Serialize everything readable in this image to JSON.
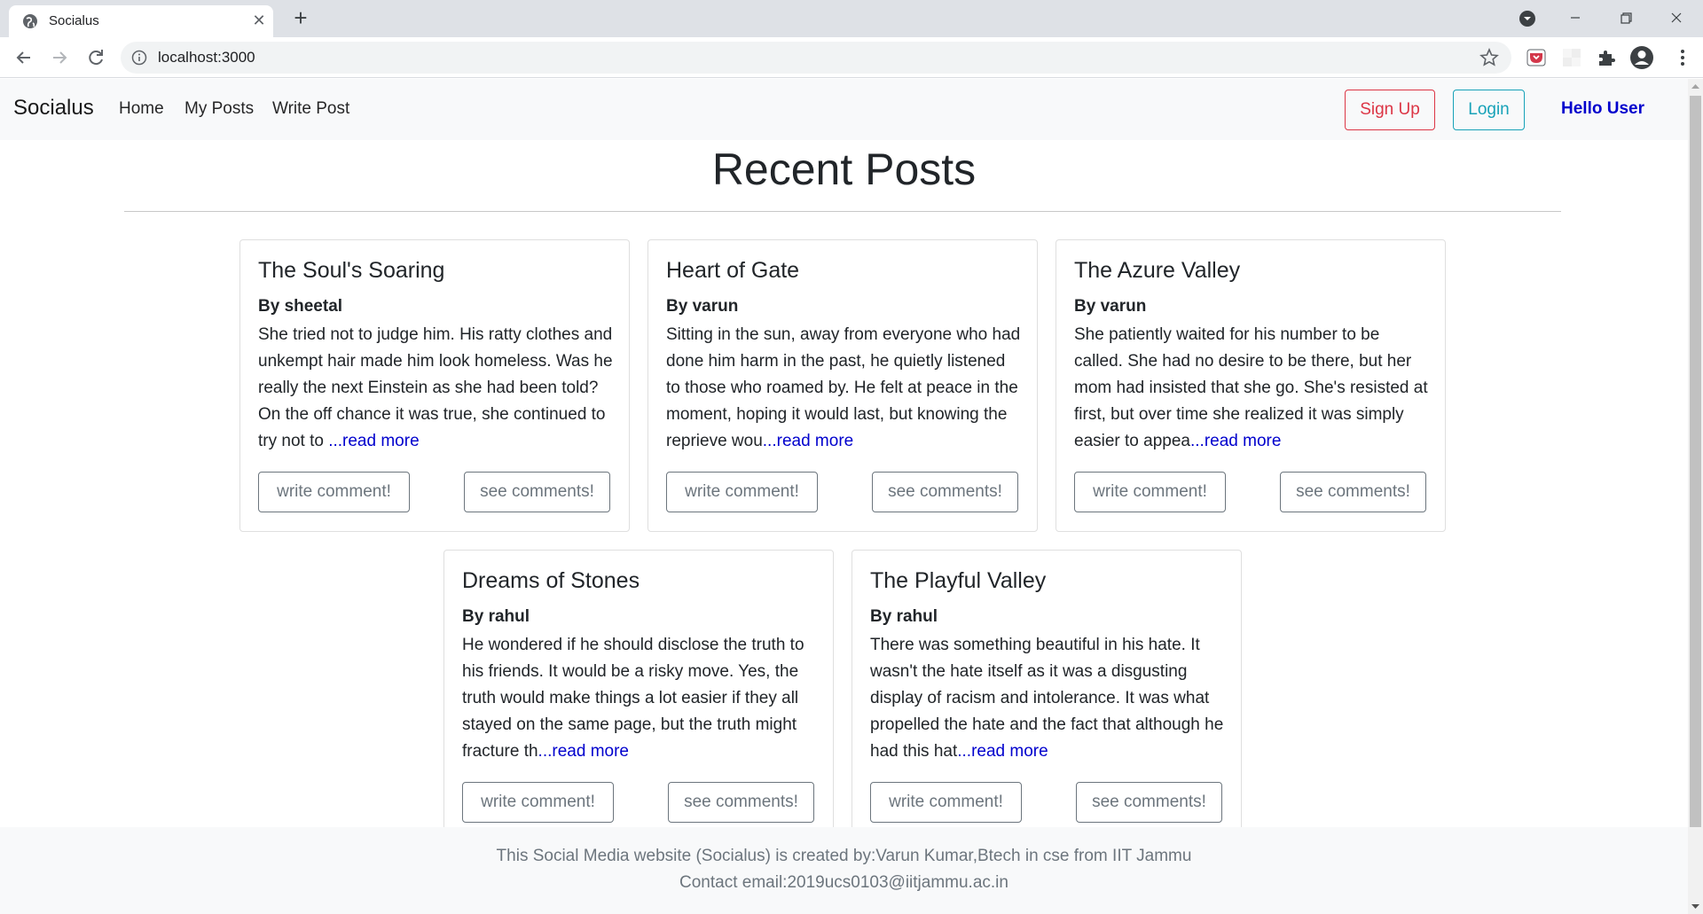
{
  "browser": {
    "tab_title": "Socialus",
    "tab_close": "✕",
    "new_tab": "+",
    "url": "localhost:3000"
  },
  "navbar": {
    "brand": "Socialus",
    "links": [
      "Home",
      "My Posts",
      "Write Post"
    ],
    "signup": "Sign Up",
    "login": "Login",
    "greeting": "Hello User"
  },
  "main": {
    "title": "Recent Posts"
  },
  "posts": [
    {
      "title": "The Soul's Soaring",
      "author": "By sheetal",
      "excerpt": "She tried not to judge him. His ratty clothes and unkempt hair made him look homeless. Was he really the next Einstein as she had been told? On the off chance it was true, she continued to try not to ",
      "read_more": "...read more",
      "write_comment": "write comment!",
      "see_comments": "see comments!"
    },
    {
      "title": "Heart of Gate",
      "author": "By varun",
      "excerpt": "Sitting in the sun, away from everyone who had done him harm in the past, he quietly listened to those who roamed by. He felt at peace in the moment, hoping it would last, but knowing the reprieve wou",
      "read_more": "...read more",
      "write_comment": "write comment!",
      "see_comments": "see comments!"
    },
    {
      "title": "The Azure Valley",
      "author": "By varun",
      "excerpt": "She patiently waited for his number to be called. She had no desire to be there, but her mom had insisted that she go. She's resisted at first, but over time she realized it was simply easier to appea",
      "read_more": "...read more",
      "write_comment": "write comment!",
      "see_comments": "see comments!"
    },
    {
      "title": "Dreams of Stones",
      "author": "By rahul",
      "excerpt": "He wondered if he should disclose the truth to his friends. It would be a risky move. Yes, the truth would make things a lot easier if they all stayed on the same page, but the truth might fracture th",
      "read_more": "...read more",
      "write_comment": "write comment!",
      "see_comments": "see comments!"
    },
    {
      "title": "The Playful Valley",
      "author": "By rahul",
      "excerpt": "There was something beautiful in his hate. It wasn't the hate itself as it was a disgusting display of racism and intolerance. It was what propelled the hate and the fact that although he had this hat",
      "read_more": "...read more",
      "write_comment": "write comment!",
      "see_comments": "see comments!"
    }
  ],
  "footer": {
    "line1": "This Social Media website (Socialus) is created by:Varun Kumar,Btech in cse from IIT Jammu",
    "line2": "Contact email:2019ucs0103@iitjammu.ac.in"
  },
  "colors": {
    "signup": "#dc3545",
    "login": "#17a2b8",
    "greeting": "#0000cd",
    "link": "#0000cd",
    "secondary": "#6c757d"
  },
  "icons": [
    "globe-icon",
    "close-icon",
    "plus-icon",
    "tab-search-icon",
    "minimize-icon",
    "maximize-icon",
    "close-window-icon",
    "back-icon",
    "forward-icon",
    "reload-icon",
    "info-icon",
    "star-icon",
    "pocket-icon",
    "extension-icon",
    "puzzle-icon",
    "profile-icon",
    "menu-icon"
  ]
}
